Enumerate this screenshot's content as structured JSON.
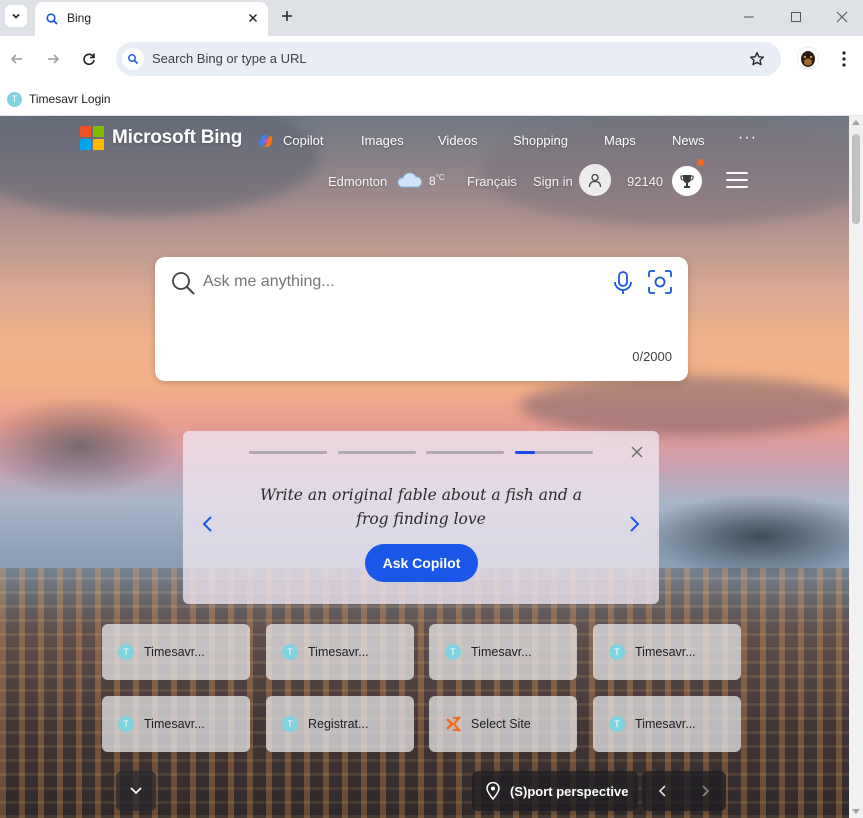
{
  "browser": {
    "tab": {
      "title": "Bing"
    },
    "omnibox": {
      "placeholder": "Search Bing or type a URL"
    },
    "bookmarks": [
      {
        "label": "Timesavr Login",
        "favicon_letter": "T"
      }
    ]
  },
  "bing": {
    "brand": "Microsoft Bing",
    "nav": [
      "Copilot",
      "Images",
      "Videos",
      "Shopping",
      "Maps",
      "News"
    ],
    "more": "···",
    "location": "Edmonton",
    "temperature": "8",
    "temperature_unit": "°C",
    "language": "Français",
    "signin": "Sign in",
    "rewards_points": "92140",
    "search": {
      "placeholder": "Ask me anything...",
      "char_count": "0/2000"
    },
    "copilot_card": {
      "prompt": "Write an original fable about a fish and a frog finding love",
      "button": "Ask Copilot",
      "active_step": 4,
      "step_count": 4,
      "active_step_fill": 0.25
    },
    "quick_links": [
      {
        "label": "Timesavr...",
        "icon": "T"
      },
      {
        "label": "Timesavr...",
        "icon": "T"
      },
      {
        "label": "Timesavr...",
        "icon": "T"
      },
      {
        "label": "Timesavr...",
        "icon": "T"
      },
      {
        "label": "Timesavr...",
        "icon": "T"
      },
      {
        "label": "Registrat...",
        "icon": "T"
      },
      {
        "label": "Select Site",
        "icon": "select-site-icon"
      },
      {
        "label": "Timesavr...",
        "icon": "T"
      }
    ],
    "image_caption": "(S)port perspective"
  },
  "colors": {
    "accent": "#1a56e8",
    "ms_red": "#f25022",
    "ms_green": "#7fba00",
    "ms_blue": "#00a4ef",
    "ms_yellow": "#ffb900",
    "favicon_teal": "#7fd3e0"
  }
}
